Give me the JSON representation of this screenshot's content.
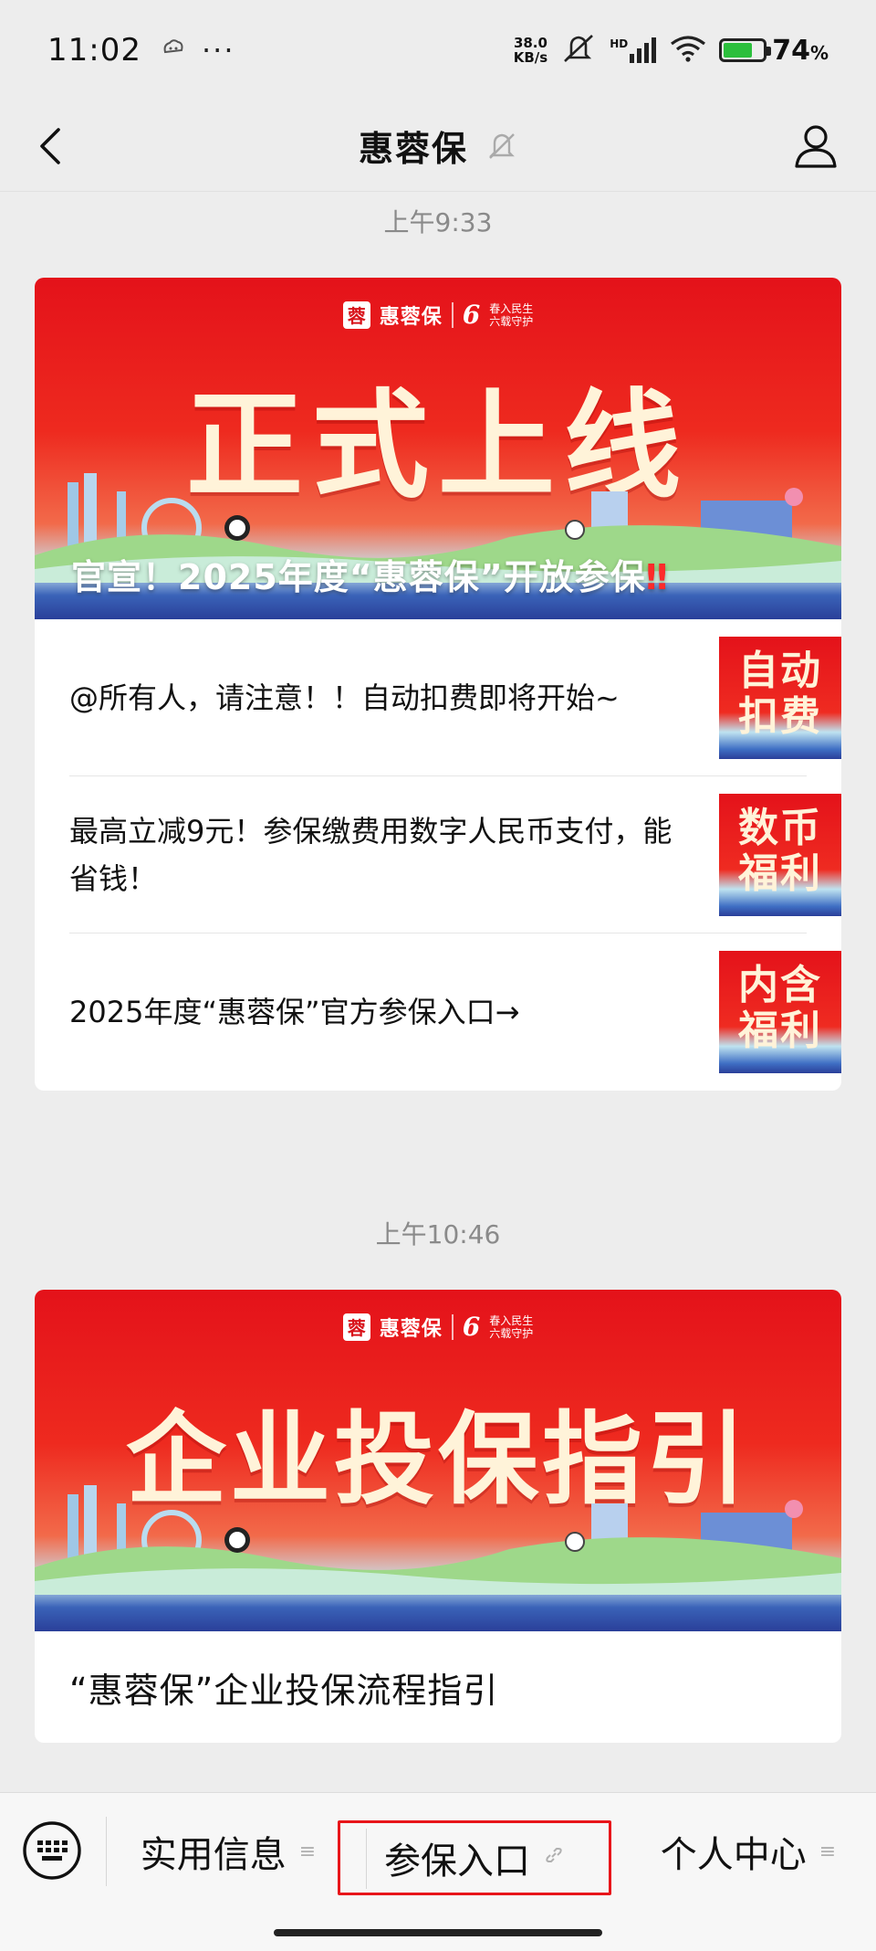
{
  "status_bar": {
    "time": "11:02",
    "net_speed_value": "38.0",
    "net_speed_unit": "KB/s",
    "signal_label": "HD",
    "battery": "74",
    "battery_unit": "%",
    "battery_level": 0.74,
    "dots": "···"
  },
  "nav": {
    "title": "惠蓉保",
    "back_icon": "chevron-left-icon",
    "mute_icon": "bell-off-icon",
    "profile_icon": "person-icon"
  },
  "messages": [
    {
      "timestamp": "上午9:33",
      "banner": {
        "logo_text": "惠蓉保",
        "logo_badge": "蓉",
        "logo_six": "6",
        "logo_slogan_1": "春入民生",
        "logo_slogan_2": "六载守护",
        "headline": "正式上线",
        "caption": "官宣！2025年度“惠蓉保”开放参保",
        "caption_mark": "‼"
      },
      "articles": [
        {
          "title": "@所有人，请注意！！自动扣费即将开始~",
          "thumb": "自动扣费"
        },
        {
          "title": "最高立减9元！参保缴费用数字人民币支付，能省钱！",
          "thumb": "数币福利"
        },
        {
          "title": "2025年度“惠蓉保”官方参保入口→",
          "thumb": "内含福利"
        }
      ]
    },
    {
      "timestamp": "上午10:46",
      "banner": {
        "logo_text": "惠蓉保",
        "logo_badge": "蓉",
        "logo_six": "6",
        "logo_slogan_1": "春入民生",
        "logo_slogan_2": "六载守护",
        "headline": "企业投保指引"
      },
      "single_article": "“惠蓉保”企业投保流程指引"
    }
  ],
  "bottom_menu": {
    "keyboard_icon": "keyboard-icon",
    "items": [
      {
        "label": "实用信息",
        "glyph": "≡"
      },
      {
        "label": "参保入口",
        "glyph": "🔗"
      },
      {
        "label": "个人中心",
        "glyph": "≡"
      }
    ]
  },
  "colors": {
    "highlight_border": "#e8151a",
    "banner_red": "#e4121a"
  }
}
